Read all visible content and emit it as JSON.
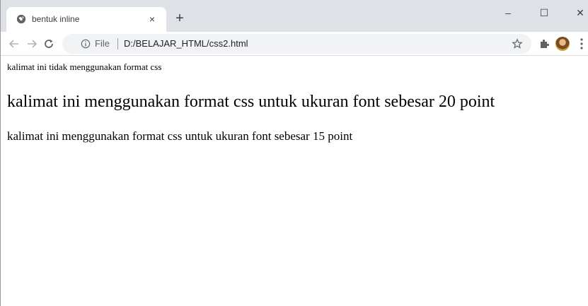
{
  "tab": {
    "title": "bentuk inline",
    "close_glyph": "×",
    "favicon": "globe-icon"
  },
  "new_tab_glyph": "+",
  "window_controls": {
    "minimize": "–",
    "maximize": "☐",
    "close": "✕"
  },
  "toolbar": {
    "back": "arrow-left-icon",
    "forward": "arrow-right-icon",
    "reload": "reload-icon"
  },
  "omnibox": {
    "scheme_label": "File",
    "url": "D:/BELAJAR_HTML/css2.html"
  },
  "content": {
    "line1": "kalimat ini tidak menggunakan format css",
    "line2": "kalimat ini menggunakan format css untuk ukuran font sebesar 20 point",
    "line3": "kalimat ini menggunakan format css untuk ukuran font sebesar 15 point"
  }
}
